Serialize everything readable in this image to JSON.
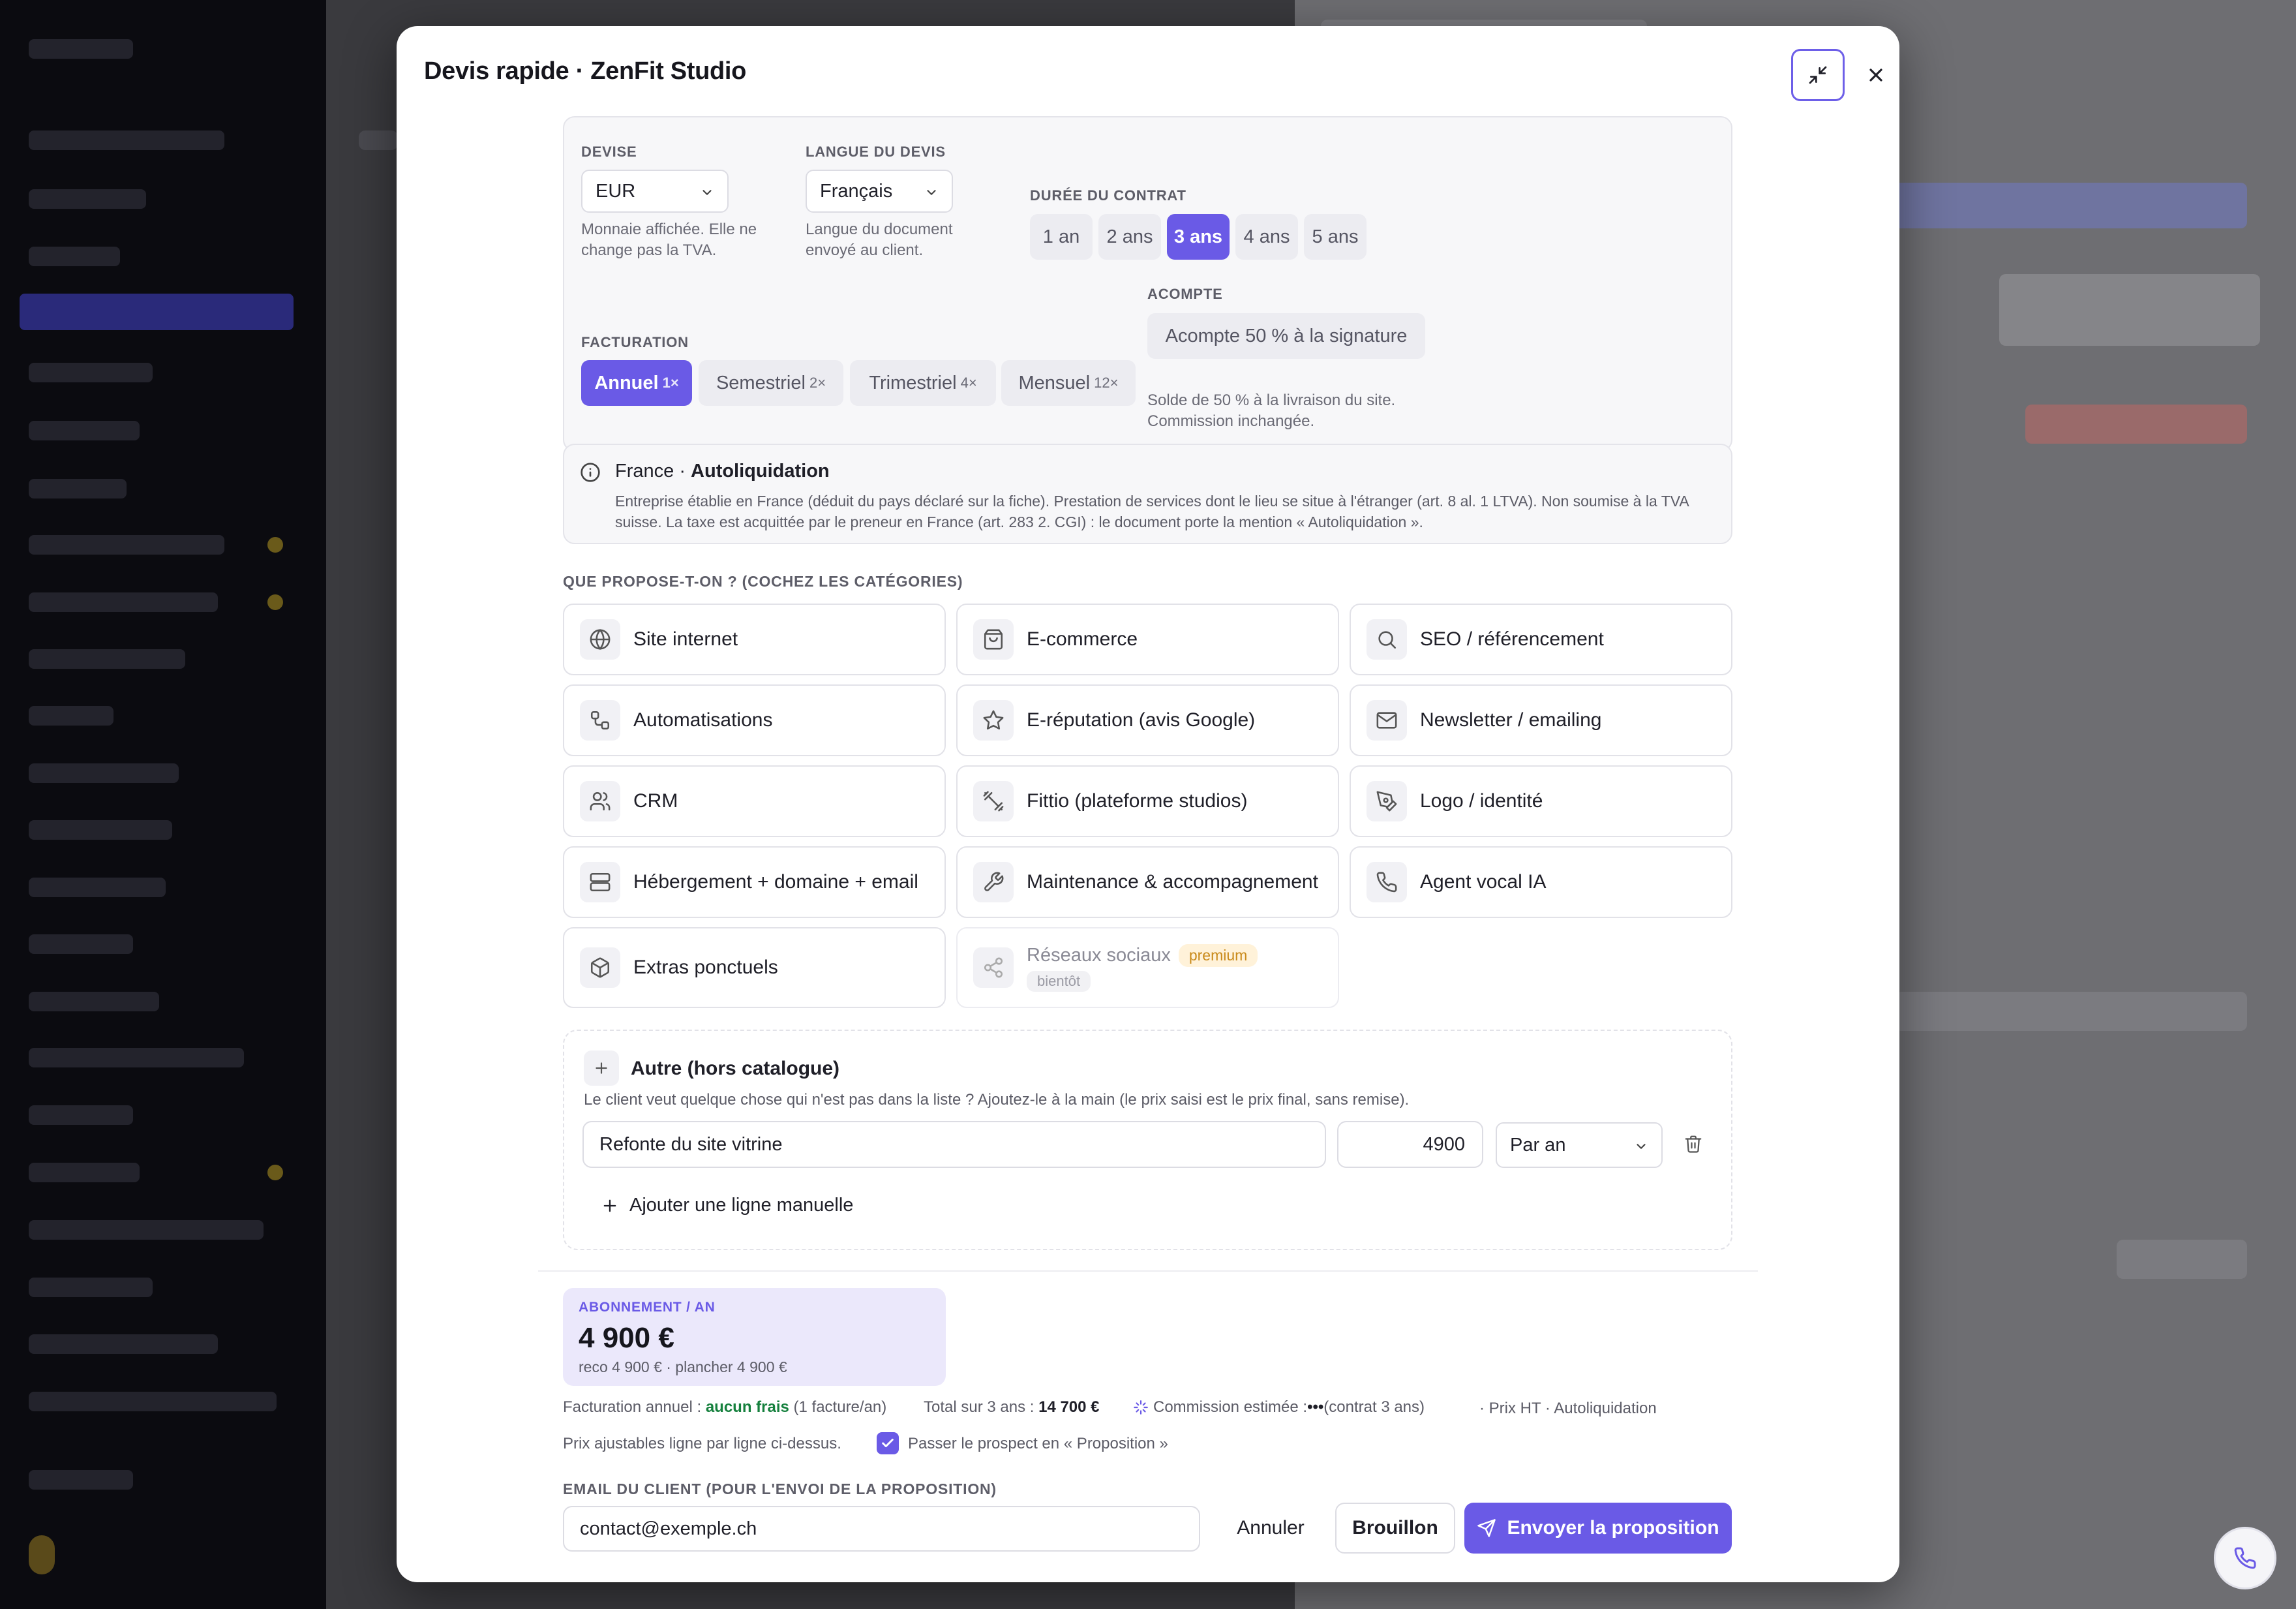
{
  "modal": {
    "title": "Devis rapide · ZenFit Studio"
  },
  "settings": {
    "devise": {
      "label": "DEVISE",
      "value": "EUR",
      "help": "Monnaie affichée. Elle ne change pas la TVA."
    },
    "langue": {
      "label": "LANGUE DU DEVIS",
      "value": "Français",
      "help": "Langue du document envoyé au client."
    },
    "duree": {
      "label": "DURÉE DU CONTRAT",
      "options": [
        "1 an",
        "2 ans",
        "3 ans",
        "4 ans",
        "5 ans"
      ],
      "selected": "3 ans"
    },
    "facturation": {
      "label": "FACTURATION",
      "options": [
        {
          "label": "Annuel",
          "mult": "1×"
        },
        {
          "label": "Semestriel",
          "mult": "2×"
        },
        {
          "label": "Trimestriel",
          "mult": "4×"
        },
        {
          "label": "Mensuel",
          "mult": "12×"
        }
      ],
      "selected": "Annuel"
    },
    "acompte": {
      "label": "ACOMPTE",
      "value": "Acompte 50 % à la signature",
      "help": "Solde de 50 % à la livraison du site. Commission inchangée."
    }
  },
  "info": {
    "country": "France · ",
    "regime": "Autoliquidation",
    "body": "Entreprise établie en France (déduit du pays déclaré sur la fiche). Prestation de services dont le lieu se situe à l'étranger (art. 8 al. 1 LTVA). Non soumise à la TVA suisse. La taxe est acquittée par le preneur en France (art. 283 2. CGI) : le document porte la mention « Autoliquidation »."
  },
  "categories": {
    "heading": "QUE PROPOSE-T-ON ? (COCHEZ LES CATÉGORIES)",
    "items": [
      {
        "label": "Site internet",
        "icon": "globe-icon"
      },
      {
        "label": "E-commerce",
        "icon": "shopping-bag-icon"
      },
      {
        "label": "SEO / référencement",
        "icon": "search-icon"
      },
      {
        "label": "Automatisations",
        "icon": "workflow-icon"
      },
      {
        "label": "E-réputation (avis Google)",
        "icon": "star-icon"
      },
      {
        "label": "Newsletter / emailing",
        "icon": "mail-icon"
      },
      {
        "label": "CRM",
        "icon": "users-icon"
      },
      {
        "label": "Fittio (plateforme studios)",
        "icon": "dumbbell-icon"
      },
      {
        "label": "Logo / identité",
        "icon": "pen-tool-icon"
      },
      {
        "label": "Hébergement + domaine + email",
        "icon": "server-icon"
      },
      {
        "label": "Maintenance & accompagnement",
        "icon": "wrench-icon"
      },
      {
        "label": "Agent vocal IA",
        "icon": "phone-icon"
      },
      {
        "label": "Extras ponctuels",
        "icon": "package-icon"
      },
      {
        "label": "Réseaux sociaux",
        "icon": "share-icon",
        "badge": "premium",
        "status": "bientôt"
      }
    ]
  },
  "autre": {
    "title": "Autre (hors catalogue)",
    "description": "Le client veut quelque chose qui n'est pas dans la liste ? Ajoutez-le à la main (le prix saisi est le prix final, sans remise).",
    "line": {
      "name": "Refonte du site vitrine",
      "price": "4900",
      "period": "Par an"
    },
    "add_label": "Ajouter une ligne manuelle"
  },
  "summary": {
    "abo_label": "ABONNEMENT / AN",
    "abo_price": "4 900 €",
    "abo_reco": "reco 4 900 € · plancher 4 900 €",
    "facturation_prefix": "Facturation annuel : ",
    "facturation_fees": "aucun frais",
    "facturation_suffix": " (1 facture/an)",
    "total_prefix": "Total sur 3 ans : ",
    "total_value": "14 700 €",
    "commission_prefix": "Commission estimée : ",
    "commission_value": "•••",
    "commission_suffix": " (contrat 3 ans)",
    "tax_note": "· Prix HT · Autoliquidation",
    "adjust_note": "Prix ajustables ligne par ligne ci-dessus.",
    "prospect_checkbox": "Passer le prospect en « Proposition »"
  },
  "email": {
    "label": "EMAIL DU CLIENT (POUR L'ENVOI DE LA PROPOSITION)",
    "value": "contact@exemple.ch"
  },
  "actions": {
    "cancel": "Annuler",
    "draft": "Brouillon",
    "send": "Envoyer la proposition"
  },
  "colors": {
    "accent": "#6a5ae6",
    "accent_soft": "#ebe8fb",
    "success": "#15803d",
    "premium": "#c98a1a"
  }
}
